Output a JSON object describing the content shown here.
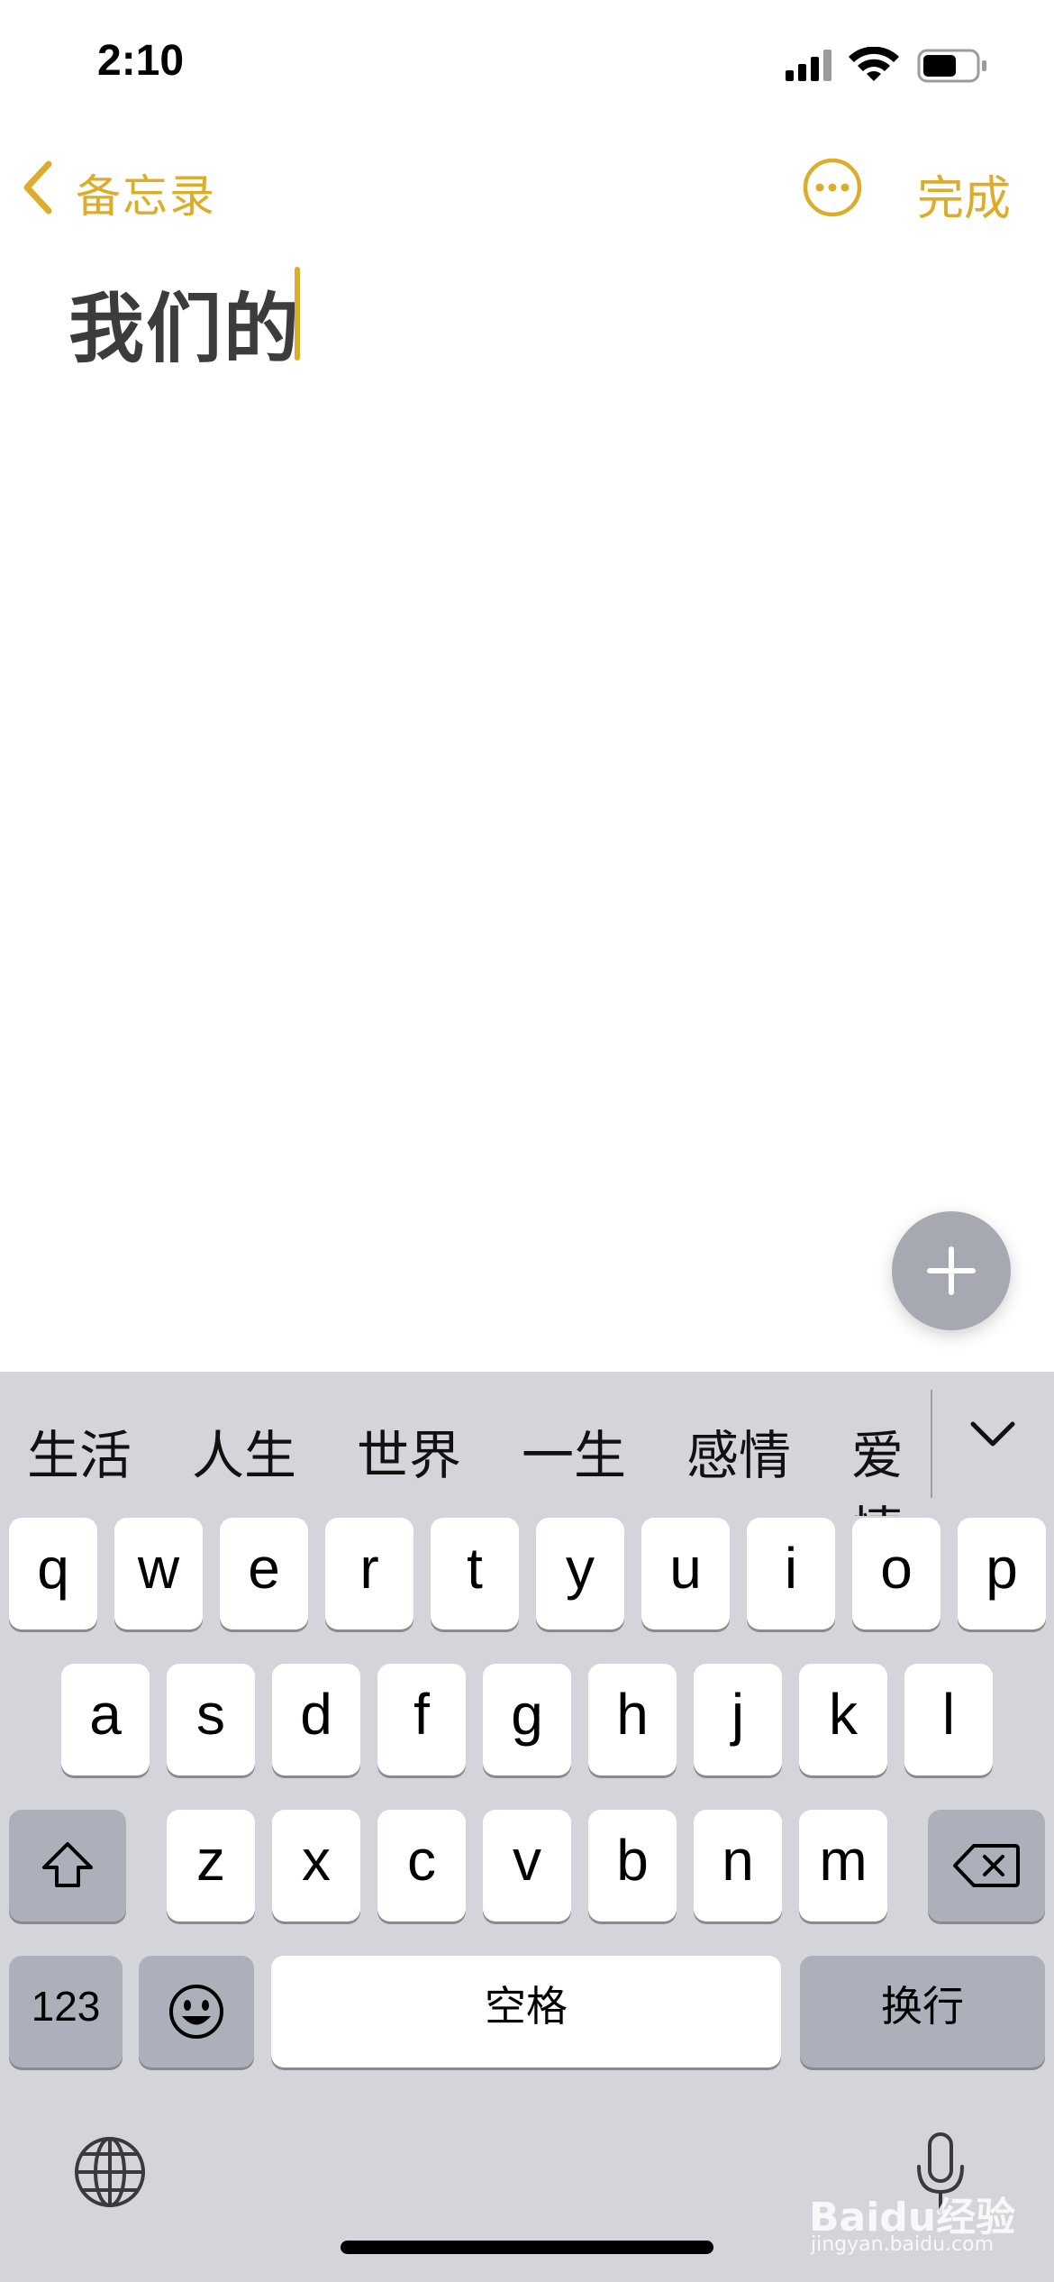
{
  "status_bar": {
    "time": "2:10"
  },
  "nav": {
    "back_label": "备忘录",
    "done_label": "完成"
  },
  "note": {
    "title": "我们的"
  },
  "accent_color": "#dcac2b",
  "keyboard": {
    "candidates": [
      "生活",
      "人生",
      "世界",
      "一生",
      "感情",
      "爱情"
    ],
    "row1": [
      "q",
      "w",
      "e",
      "r",
      "t",
      "y",
      "u",
      "i",
      "o",
      "p"
    ],
    "row2": [
      "a",
      "s",
      "d",
      "f",
      "g",
      "h",
      "j",
      "k",
      "l"
    ],
    "row3": [
      "z",
      "x",
      "c",
      "v",
      "b",
      "n",
      "m"
    ],
    "numbers_label": "123",
    "space_label": "空格",
    "return_label": "换行"
  },
  "watermark": {
    "brand": "Baidu经验",
    "url": "jingyan.baidu.com"
  }
}
